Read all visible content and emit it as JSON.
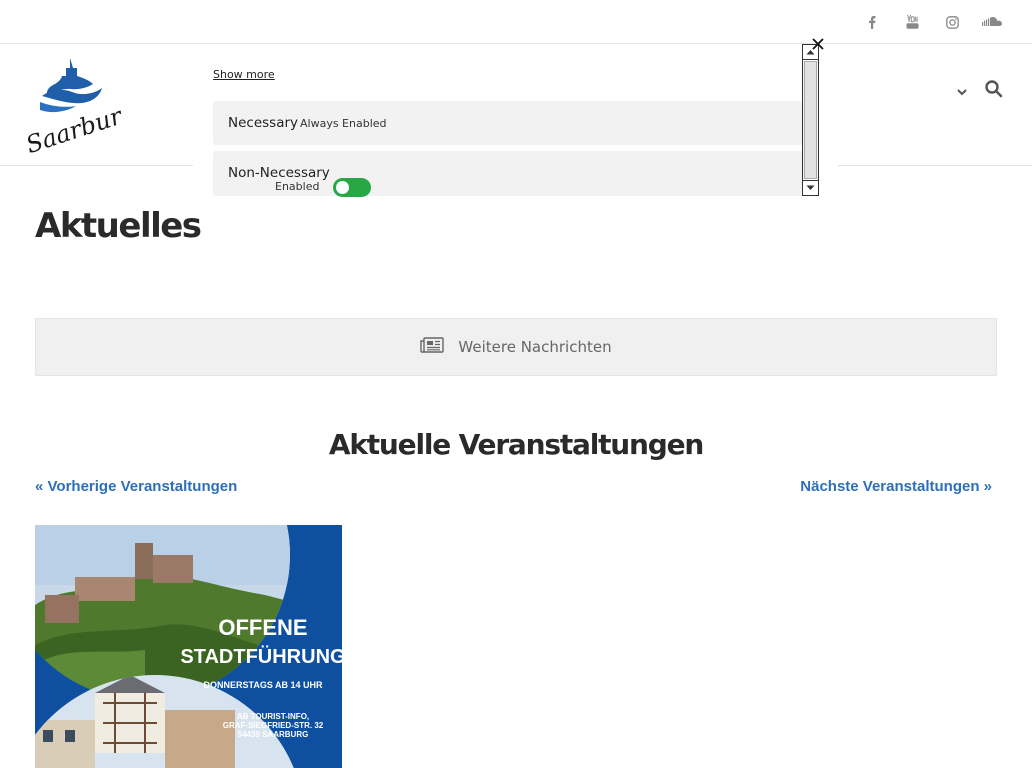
{
  "topbar": {
    "social": [
      "facebook-icon",
      "youtube-icon",
      "instagram-icon",
      "soundcloud-icon"
    ],
    "icon_color": "#888888"
  },
  "header": {
    "logo_text": "Saarburg",
    "icons": [
      "chevron-down-icon",
      "search-icon"
    ]
  },
  "page": {
    "title": "Aktuelles",
    "news_button_label": "Weitere Nachrichten",
    "news_icon": "newspaper-icon",
    "events_title": "Aktuelle Veranstaltungen",
    "prev_link": "« Vorherige Veranstaltungen",
    "next_link": "Nächste Veranstaltungen »",
    "link_color": "#2e6fb6"
  },
  "event_image": {
    "line1": "OFFENE",
    "line2": "STADTFÜHRUNG",
    "line3": "DONNERSTAGS AB 14 UHR",
    "address1": "AB TOURIST-INFO,",
    "address2": "GRAF-SIEGFRIED-STR. 32",
    "address3": "54439 SAARBURG",
    "bg_color": "#0f4fa0"
  },
  "cookie": {
    "show_more": "Show more",
    "necessary_label": "Necessary",
    "necessary_status": "Always Enabled",
    "nonnecessary_label": "Non-Necessary",
    "nonnecessary_status": "Enabled",
    "toggle_on": true,
    "toggle_color": "#28a745",
    "close_icon": "close-icon"
  }
}
